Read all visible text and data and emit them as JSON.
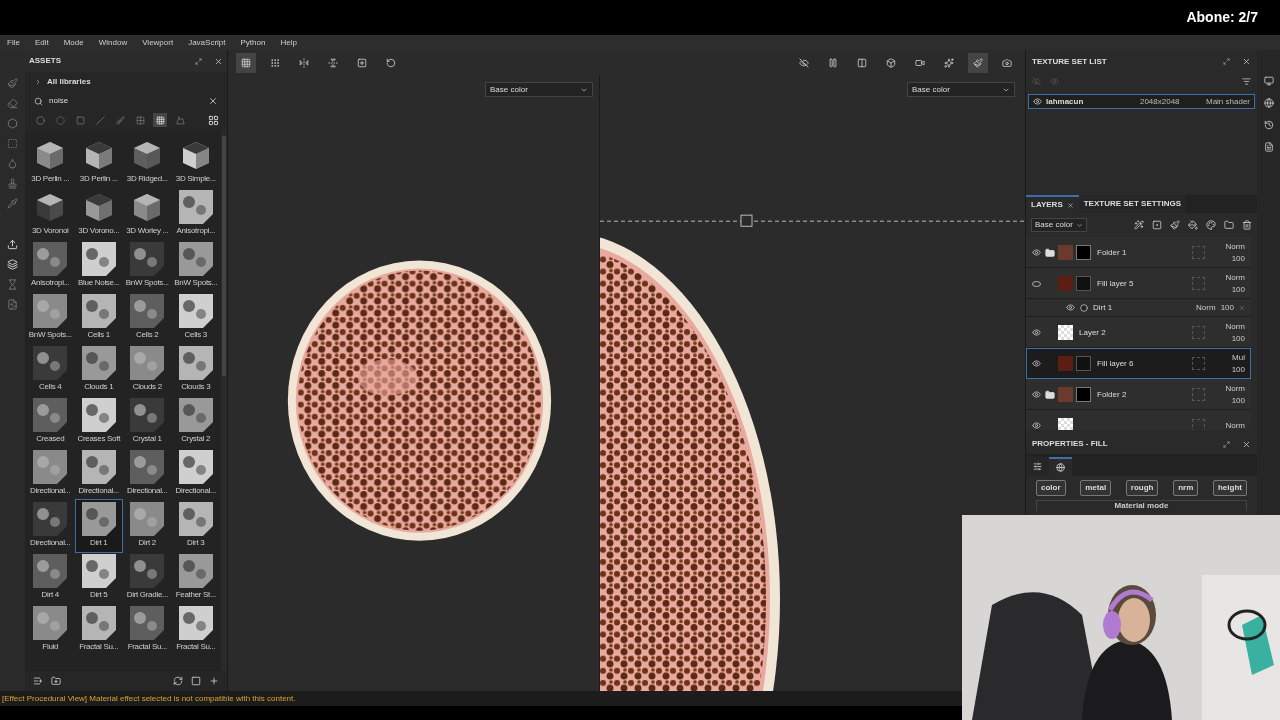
{
  "overlay": {
    "label": "Abone: 2/7"
  },
  "menu": [
    "File",
    "Edit",
    "Mode",
    "Window",
    "Viewport",
    "JavaScript",
    "Python",
    "Help"
  ],
  "assets": {
    "title": "ASSETS",
    "library": "All libraries",
    "search": "noise",
    "filters": [
      {
        "kind": "sphere",
        "selected": false
      },
      {
        "kind": "half",
        "selected": false
      },
      {
        "kind": "square",
        "selected": false
      },
      {
        "kind": "slash",
        "selected": false
      },
      {
        "kind": "brush",
        "selected": false
      },
      {
        "kind": "checker",
        "selected": false
      },
      {
        "kind": "grid",
        "selected": true
      },
      {
        "kind": "landscape",
        "selected": false
      }
    ],
    "items": [
      {
        "name": "3D Perlin ...",
        "kind": "cube",
        "selected": false
      },
      {
        "name": "3D Perlin ...",
        "kind": "cube",
        "selected": false
      },
      {
        "name": "3D Ridged...",
        "kind": "cube",
        "selected": false
      },
      {
        "name": "3D Simple...",
        "kind": "cube",
        "selected": false
      },
      {
        "name": "3D Voronoi",
        "kind": "cube",
        "selected": false
      },
      {
        "name": "3D Vorono...",
        "kind": "cube",
        "selected": false
      },
      {
        "name": "3D Worley ...",
        "kind": "cube",
        "selected": false
      },
      {
        "name": "Anisotropi...",
        "kind": "swatch",
        "selected": false
      },
      {
        "name": "Anisotropi...",
        "kind": "swatch",
        "selected": false
      },
      {
        "name": "Blue Noise...",
        "kind": "swatch",
        "selected": false
      },
      {
        "name": "BnW Spots...",
        "kind": "swatch",
        "selected": false
      },
      {
        "name": "BnW Spots...",
        "kind": "swatch",
        "selected": false
      },
      {
        "name": "BnW Spots...",
        "kind": "swatch",
        "selected": false
      },
      {
        "name": "Cells 1",
        "kind": "swatch",
        "selected": false
      },
      {
        "name": "Cells 2",
        "kind": "swatch",
        "selected": false
      },
      {
        "name": "Cells 3",
        "kind": "swatch",
        "selected": false
      },
      {
        "name": "Cells 4",
        "kind": "swatch",
        "selected": false
      },
      {
        "name": "Clouds 1",
        "kind": "swatch",
        "selected": false
      },
      {
        "name": "Clouds 2",
        "kind": "swatch",
        "selected": false
      },
      {
        "name": "Clouds 3",
        "kind": "swatch",
        "selected": false
      },
      {
        "name": "Creased",
        "kind": "swatch",
        "selected": false
      },
      {
        "name": "Creases Soft",
        "kind": "swatch",
        "selected": false
      },
      {
        "name": "Crystal 1",
        "kind": "swatch",
        "selected": false
      },
      {
        "name": "Crystal 2",
        "kind": "swatch",
        "selected": false
      },
      {
        "name": "Directional...",
        "kind": "swatch",
        "selected": false
      },
      {
        "name": "Directional...",
        "kind": "swatch",
        "selected": false
      },
      {
        "name": "Directional...",
        "kind": "swatch",
        "selected": false
      },
      {
        "name": "Directional...",
        "kind": "swatch",
        "selected": false
      },
      {
        "name": "Directional...",
        "kind": "swatch",
        "selected": false
      },
      {
        "name": "Dirt 1",
        "kind": "swatch",
        "selected": true
      },
      {
        "name": "Dirt 2",
        "kind": "swatch",
        "selected": false
      },
      {
        "name": "Dirt 3",
        "kind": "swatch",
        "selected": false
      },
      {
        "name": "Dirt 4",
        "kind": "swatch",
        "selected": false
      },
      {
        "name": "Dirt 5",
        "kind": "swatch",
        "selected": false
      },
      {
        "name": "Dirt Gradie...",
        "kind": "swatch",
        "selected": false
      },
      {
        "name": "Feather St...",
        "kind": "swatch",
        "selected": false
      },
      {
        "name": "Fluid",
        "kind": "swatch",
        "selected": false
      },
      {
        "name": "Fractal Su...",
        "kind": "swatch",
        "selected": false
      },
      {
        "name": "Fractal Su...",
        "kind": "swatch",
        "selected": false
      },
      {
        "name": "Fractal Su...",
        "kind": "swatch",
        "selected": false
      }
    ]
  },
  "toolbar": {
    "left": [
      {
        "kind": "grid",
        "selected": true
      },
      {
        "kind": "grid-menu",
        "selected": false
      },
      {
        "kind": "flip-h",
        "selected": false
      },
      {
        "kind": "flip-v",
        "selected": false
      },
      {
        "kind": "add",
        "selected": false
      },
      {
        "kind": "reset",
        "selected": false
      }
    ],
    "right": [
      {
        "kind": "hide",
        "selected": false
      },
      {
        "kind": "pause",
        "selected": false
      },
      {
        "kind": "mirror",
        "selected": false
      },
      {
        "kind": "cube",
        "selected": false
      },
      {
        "kind": "camera-video",
        "selected": false
      },
      {
        "kind": "sparkle",
        "selected": false
      },
      {
        "kind": "brush",
        "selected": true
      },
      {
        "kind": "camera",
        "selected": false
      }
    ]
  },
  "viewports": [
    {
      "kind": "perspective",
      "channel": "Base color"
    },
    {
      "kind": "uv",
      "channel": "Base color"
    }
  ],
  "texture_set_list": {
    "title": "TEXTURE SET LIST",
    "sets": [
      {
        "name": "lahmacun",
        "size": "2048x2048",
        "shader": "Main shader",
        "visible": true,
        "selected": true
      }
    ]
  },
  "layers_panel": {
    "tabs": [
      {
        "label": "LAYERS",
        "selected": true
      },
      {
        "label": "TEXTURE SET SETTINGS",
        "selected": false
      }
    ],
    "channel": "Base color",
    "layers": [
      {
        "kind": "folder",
        "name": "Folder 1",
        "visible": true,
        "selected": false,
        "blend": "Norm",
        "opacity": "100"
      },
      {
        "kind": "fill",
        "name": "Fill layer 5",
        "visible": false,
        "selected": false,
        "blend": "Norm",
        "opacity": "100",
        "children": [
          {
            "kind": "effect",
            "name": "Dirt 1",
            "visible": true,
            "blend": "Norm",
            "opacity": "100"
          }
        ]
      },
      {
        "kind": "paint",
        "name": "Layer 2",
        "visible": true,
        "selected": false,
        "blend": "Norm",
        "opacity": "100"
      },
      {
        "kind": "fill",
        "name": "Fill layer 6",
        "visible": true,
        "selected": true,
        "blend": "Mul",
        "opacity": "100"
      },
      {
        "kind": "folder",
        "name": "Folder 2",
        "visible": true,
        "selected": false,
        "blend": "Norm",
        "opacity": "100"
      },
      {
        "kind": "paint",
        "visible": true,
        "selected": false,
        "blend": "Norm"
      }
    ]
  },
  "properties": {
    "title": "PROPERTIES - FILL",
    "tabs": [
      {
        "kind": "settings",
        "selected": false
      },
      {
        "kind": "material",
        "selected": true
      }
    ],
    "channels": [
      "color",
      "metal",
      "rough",
      "nrm",
      "height"
    ],
    "mode_label": "Material mode"
  },
  "status_bar": "[Effect Procedural View] Material effect selected is not compatible with this content."
}
